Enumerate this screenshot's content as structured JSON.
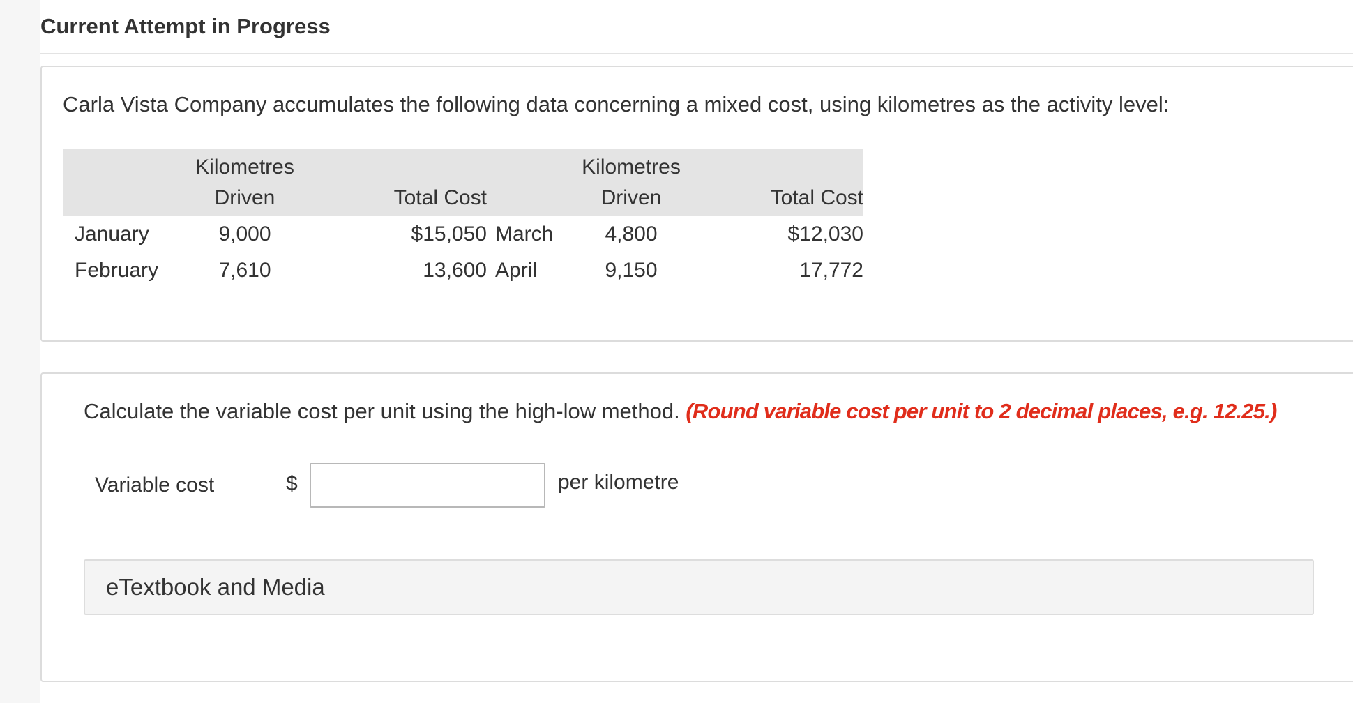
{
  "page": {
    "heading": "Current Attempt in Progress"
  },
  "problem": {
    "intro": "Carla Vista Company accumulates the following data concerning a mixed cost, using kilometres as the activity level:",
    "table": {
      "headers": {
        "left_km_line1": "Kilometres",
        "left_km_line2": "Driven",
        "left_cost": "Total Cost",
        "right_km_line1": "Kilometres",
        "right_km_line2": "Driven",
        "right_cost": "Total Cost"
      },
      "rows": [
        {
          "left_month": "January",
          "left_km": "9,000",
          "left_cost": "$15,050",
          "right_month": "March",
          "right_km": "4,800",
          "right_cost": "$12,030"
        },
        {
          "left_month": "February",
          "left_km": "7,610",
          "left_cost": "13,600",
          "right_month": "April",
          "right_km": "9,150",
          "right_cost": "17,772"
        }
      ]
    }
  },
  "question": {
    "text": "Calculate the variable cost per unit using the high-low method.",
    "hint": "(Round variable cost per unit to 2 decimal places, e.g. 12.25.)",
    "field_label": "Variable cost",
    "currency_symbol": "$",
    "input_value": "",
    "input_placeholder": "",
    "unit_label": "per kilometre"
  },
  "resources": {
    "etextbook_label": "eTextbook and Media"
  }
}
